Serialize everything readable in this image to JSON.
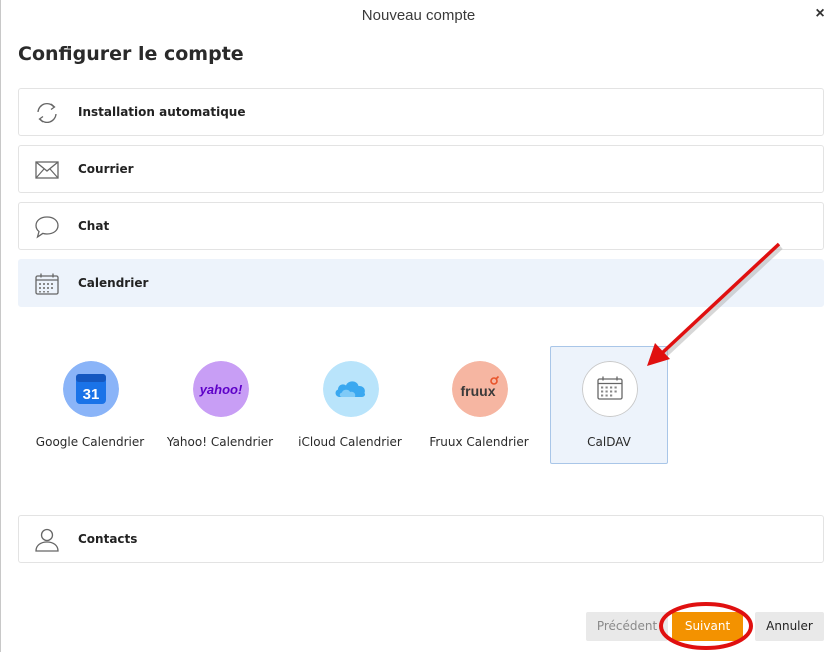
{
  "window": {
    "title": "Nouveau compte",
    "close_icon": "×"
  },
  "page": {
    "title": "Configurer le compte"
  },
  "rows": [
    {
      "id": "auto",
      "label": "Installation automatique",
      "icon": "sync-icon"
    },
    {
      "id": "mail",
      "label": "Courrier",
      "icon": "envelope-icon"
    },
    {
      "id": "chat",
      "label": "Chat",
      "icon": "chat-bubble-icon"
    },
    {
      "id": "calendar",
      "label": "Calendrier",
      "icon": "calendar-icon",
      "selected": true
    },
    {
      "id": "contacts",
      "label": "Contacts",
      "icon": "person-icon"
    }
  ],
  "providers": [
    {
      "id": "google",
      "label": "Google Calendrier",
      "logo_text": "31",
      "color": "#4285f4"
    },
    {
      "id": "yahoo",
      "label": "Yahoo! Calendrier",
      "logo_text": "yahoo!",
      "color": "#6001d2"
    },
    {
      "id": "icloud",
      "label": "iCloud Calendrier",
      "color": "#3aa8f0"
    },
    {
      "id": "fruux",
      "label": "Fruux Calendrier",
      "logo_text": "fruux",
      "color": "#e8542b"
    },
    {
      "id": "caldav",
      "label": "CalDAV",
      "selected": true
    }
  ],
  "buttons": {
    "prev": "Précédent",
    "next": "Suivant",
    "cancel": "Annuler"
  },
  "colors": {
    "accent": "#f39200",
    "selected_bg": "#edf3fb",
    "annotation": "#e01010"
  }
}
